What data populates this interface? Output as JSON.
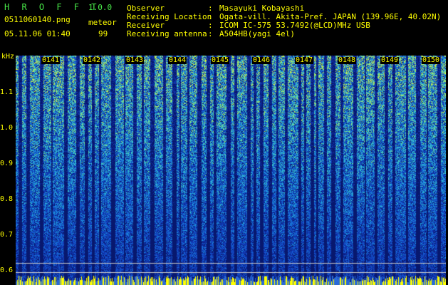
{
  "header": {
    "app_title": "H R O F F T",
    "version": "1.0.0",
    "filename": "0511060140.png",
    "mode": "meteor",
    "datetime": "05.11.06 01:40",
    "count": "99"
  },
  "info": [
    {
      "label": "Observer",
      "value": "Masayuki Kobayashi"
    },
    {
      "label": "Receiving Location",
      "value": "Ogata-vill. Akita-Pref. JAPAN (139.96E, 40.02N)"
    },
    {
      "label": "Receiver",
      "value": "ICOM IC-575 53.7492(@LCD)MHz USB"
    },
    {
      "label": "Receiving antenna",
      "value": "A504HB(yagi 4el)"
    }
  ],
  "axis": {
    "unit": "kHz",
    "y_ticks": [
      "1.1",
      "1.0",
      "0.9",
      "0.8",
      "0.7",
      "0.6"
    ],
    "x_ticks": [
      "0141",
      "0142",
      "0143",
      "0144",
      "0145",
      "0146",
      "0147",
      "0148",
      "0149",
      "0150"
    ]
  },
  "colors": {
    "text_green": "#48e848",
    "text_yellow": "#ffff00",
    "background": "#000000"
  }
}
